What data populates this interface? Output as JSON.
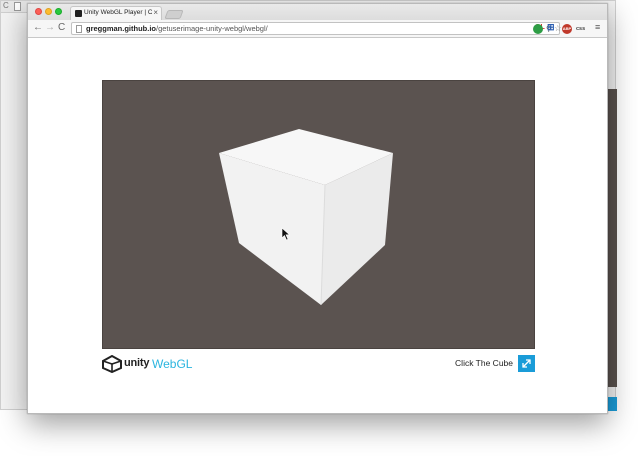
{
  "background_window": {
    "reload_glyph": "C"
  },
  "browser": {
    "tab": {
      "title": "Unity WebGL Player | Click The Cube",
      "close_glyph": "×"
    },
    "toolbar": {
      "back_glyph": "←",
      "forward_glyph": "→",
      "reload_glyph": "C"
    },
    "address_bar": {
      "host": "greggman.github.io",
      "path": "/getuserimage-unity-webgl/webgl/",
      "gl_badge": "GL",
      "search_glyph": "⚲",
      "star_glyph": "☆"
    },
    "extensions": {
      "ext3_label": "ABP",
      "ext4_label": "css",
      "menu_glyph": "≡",
      "ext2_glyph": "⊞"
    }
  },
  "unity_player": {
    "logo_word": "unity",
    "logo_webgl": "WebGL",
    "title": "Click The Cube"
  },
  "colors": {
    "canvas_bg": "#5b5350",
    "webgl_accent": "#2bb5df",
    "fullscreen_button": "#1a9cd8"
  }
}
